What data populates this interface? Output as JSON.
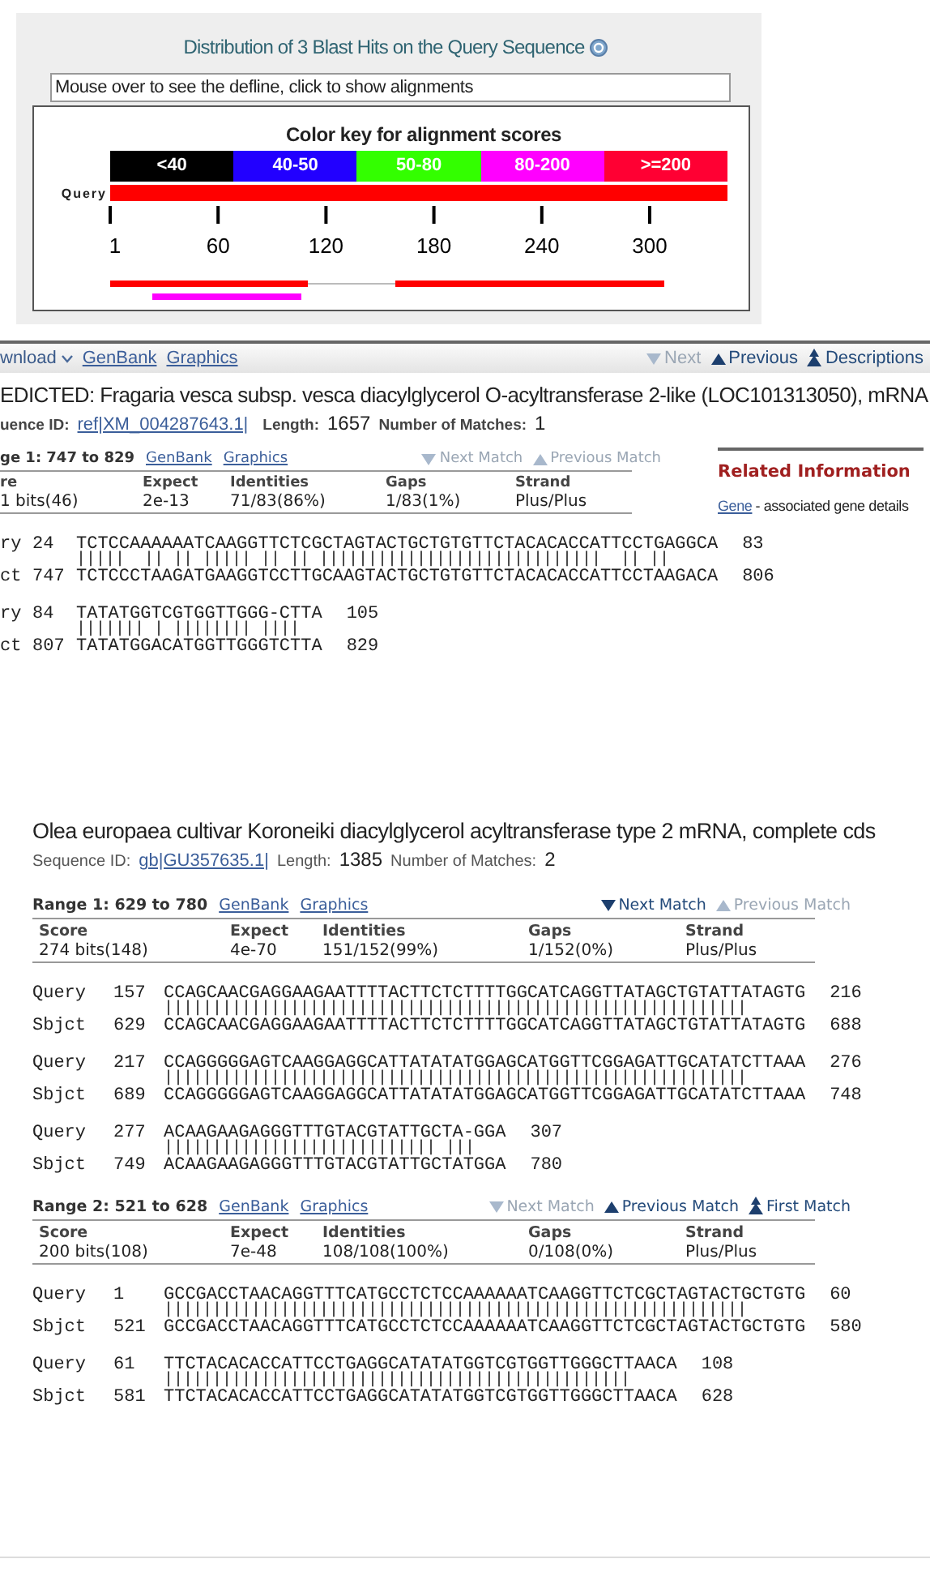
{
  "graphic": {
    "title": "Distribution of 3 Blast Hits on the Query Sequence",
    "defline": "Mouse over to see the defline, click to show alignments",
    "key_title": "Color key for alignment scores",
    "key": [
      {
        "label": "<40",
        "color": "#000000"
      },
      {
        "label": "40-50",
        "color": "#2200ff"
      },
      {
        "label": "50-80",
        "color": "#33ff00"
      },
      {
        "label": "80-200",
        "color": "#ff00ff"
      },
      {
        "label": ">=200",
        "color": "#ff0033"
      }
    ],
    "query_label": "Query",
    "ticks": [
      "1",
      "60",
      "120",
      "180",
      "240",
      "300"
    ]
  },
  "toolbar": {
    "links": [
      {
        "label": "wnload",
        "kind": "menu"
      },
      {
        "label": "GenBank",
        "kind": "link"
      },
      {
        "label": "Graphics",
        "kind": "link"
      }
    ],
    "nav": [
      {
        "label": "Next",
        "kind": "down",
        "disabled": true
      },
      {
        "label": "Previous",
        "kind": "up",
        "disabled": false
      },
      {
        "label": "Descriptions",
        "kind": "top",
        "disabled": false
      }
    ]
  },
  "hits": [
    {
      "title": "EDICTED: Fragaria vesca subsp. vesca diacylglycerol O-acyltransferase 2-like (LOC101313050), mRNA",
      "seq_id_label": "uence ID:",
      "seq_id": "ref|XM_004287643.1|",
      "length_label": "Length:",
      "length": "1657",
      "matches_label": "Number of Matches:",
      "matches": "1",
      "related": {
        "title": "Related Information",
        "link": "Gene",
        "text": "- associated gene details"
      },
      "ranges": [
        {
          "label": "ge 1: 747 to 829",
          "links": [
            "GenBank",
            "Graphics"
          ],
          "nav": [
            {
              "label": "Next Match",
              "kind": "down",
              "disabled": true
            },
            {
              "label": "Previous Match",
              "kind": "up",
              "disabled": true
            }
          ],
          "headers": [
            "re",
            "Expect",
            "Identities",
            "Gaps",
            "Strand"
          ],
          "values": [
            "1 bits(46)",
            "2e-13",
            "71/83(86%)",
            "1/83(1%)",
            "Plus/Plus"
          ],
          "blocks": [
            {
              "query": {
                "label": "ry",
                "start": "24",
                "seq": "TCTCCAAAAAATCAAGGTTCTCGCTAGTACTGCTGTGTTCTACACACCATTCCTGAGGCA",
                "end": "83"
              },
              "midline": "|||||  || || ||||| || || |||||||||||||||||||||||||||||  || ||",
              "sbjct": {
                "label": "ct",
                "start": "747",
                "seq": "TCTCCCTAAGATGAAGGTCCTTGCAAGTACTGCTGTGTTCTACACACCATTCCTAAGACA",
                "end": "806"
              }
            },
            {
              "query": {
                "label": "ry",
                "start": "84",
                "seq": "TATATGGTCGTGGTTGGG-CTTA",
                "end": "105"
              },
              "midline": "||||||| | |||||||| ||||",
              "sbjct": {
                "label": "ct",
                "start": "807",
                "seq": "TATATGGACATGGTTGGGTCTTA",
                "end": "829"
              }
            }
          ]
        }
      ]
    },
    {
      "title": "Olea europaea cultivar Koroneiki diacylglycerol acyltransferase type 2 mRNA, complete cds",
      "seq_id_label": "Sequence ID:",
      "seq_id": "gb|GU357635.1|",
      "length_label": "Length:",
      "length": "1385",
      "matches_label": "Number of Matches:",
      "matches": "2",
      "ranges": [
        {
          "label": "Range 1: 629 to 780",
          "links": [
            "GenBank",
            "Graphics"
          ],
          "nav": [
            {
              "label": "Next Match",
              "kind": "down",
              "disabled": false
            },
            {
              "label": "Previous Match",
              "kind": "up",
              "disabled": true
            }
          ],
          "headers": [
            "Score",
            "Expect",
            "Identities",
            "Gaps",
            "Strand"
          ],
          "values": [
            "274 bits(148)",
            "4e-70",
            "151/152(99%)",
            "1/152(0%)",
            "Plus/Plus"
          ],
          "blocks": [
            {
              "query": {
                "label": "Query",
                "start": "157",
                "seq": "CCAGCAACGAGGAAGAATTTTACTTCTCTTTTGGCATCAGGTTATAGCTGTATTATAGTG",
                "end": "216"
              },
              "midline": "||||||||||||||||||||||||||||||||||||||||||||||||||||||||||||",
              "sbjct": {
                "label": "Sbjct",
                "start": "629",
                "seq": "CCAGCAACGAGGAAGAATTTTACTTCTCTTTTGGCATCAGGTTATAGCTGTATTATAGTG",
                "end": "688"
              }
            },
            {
              "query": {
                "label": "Query",
                "start": "217",
                "seq": "CCAGGGGGAGTCAAGGAGGCATTATATATGGAGCATGGTTCGGAGATTGCATATCTTAAA",
                "end": "276"
              },
              "midline": "||||||||||||||||||||||||||||||||||||||||||||||||||||||||||||",
              "sbjct": {
                "label": "Sbjct",
                "start": "689",
                "seq": "CCAGGGGGAGTCAAGGAGGCATTATATATGGAGCATGGTTCGGAGATTGCATATCTTAAA",
                "end": "748"
              }
            },
            {
              "query": {
                "label": "Query",
                "start": "277",
                "seq": "ACAAGAAGAGGGTTTGTACGTATTGCTA-GGA",
                "end": "307"
              },
              "midline": "|||||||||||||||||||||||||||| |||",
              "sbjct": {
                "label": "Sbjct",
                "start": "749",
                "seq": "ACAAGAAGAGGGTTTGTACGTATTGCTATGGA",
                "end": "780"
              }
            }
          ]
        },
        {
          "label": "Range 2: 521 to 628",
          "links": [
            "GenBank",
            "Graphics"
          ],
          "nav": [
            {
              "label": "Next Match",
              "kind": "down",
              "disabled": true
            },
            {
              "label": "Previous Match",
              "kind": "up",
              "disabled": false
            },
            {
              "label": "First Match",
              "kind": "top",
              "disabled": false
            }
          ],
          "headers": [
            "Score",
            "Expect",
            "Identities",
            "Gaps",
            "Strand"
          ],
          "values": [
            "200 bits(108)",
            "7e-48",
            "108/108(100%)",
            "0/108(0%)",
            "Plus/Plus"
          ],
          "blocks": [
            {
              "query": {
                "label": "Query",
                "start": "1",
                "seq": "GCCGACCTAACAGGTTTCATGCCTCTCCAAAAAATCAAGGTTCTCGCTAGTACTGCTGTG",
                "end": "60"
              },
              "midline": "||||||||||||||||||||||||||||||||||||||||||||||||||||||||||||",
              "sbjct": {
                "label": "Sbjct",
                "start": "521",
                "seq": "GCCGACCTAACAGGTTTCATGCCTCTCCAAAAAATCAAGGTTCTCGCTAGTACTGCTGTG",
                "end": "580"
              }
            },
            {
              "query": {
                "label": "Query",
                "start": "61",
                "seq": "TTCTACACACCATTCCTGAGGCATATATGGTCGTGGTTGGGCTTAACA",
                "end": "108"
              },
              "midline": "||||||||||||||||||||||||||||||||||||||||||||||||",
              "sbjct": {
                "label": "Sbjct",
                "start": "581",
                "seq": "TTCTACACACCATTCCTGAGGCATATATGGTCGTGGTTGGGCTTAACA",
                "end": "628"
              }
            }
          ]
        }
      ]
    }
  ]
}
